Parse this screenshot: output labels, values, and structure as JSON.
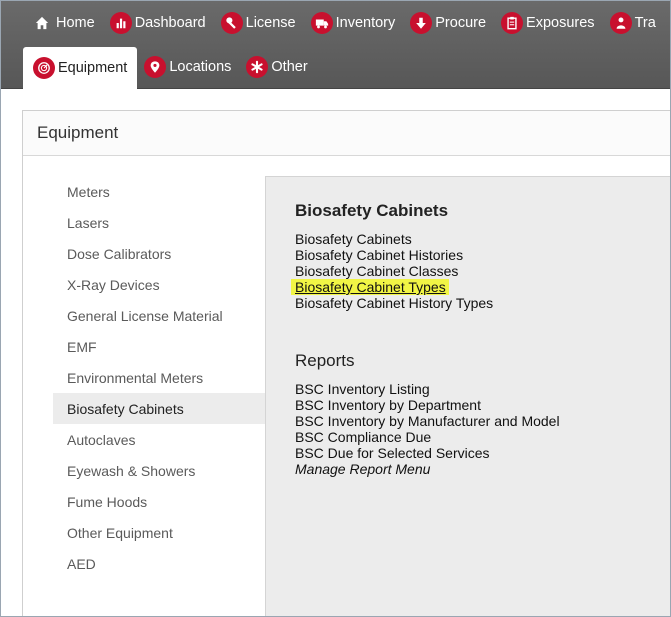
{
  "topnav": {
    "row1": [
      {
        "label": "Home",
        "icon": "home-icon"
      },
      {
        "label": "Dashboard",
        "icon": "bar-chart-icon"
      },
      {
        "label": "License",
        "icon": "wrench-icon"
      },
      {
        "label": "Inventory",
        "icon": "truck-icon"
      },
      {
        "label": "Procure",
        "icon": "down-arrow-icon"
      },
      {
        "label": "Exposures",
        "icon": "clipboard-icon"
      },
      {
        "label": "Tra",
        "icon": "person-icon"
      }
    ],
    "row2": [
      {
        "label": "Equipment",
        "icon": "gauge-icon",
        "active": true
      },
      {
        "label": "Locations",
        "icon": "map-pin-icon"
      },
      {
        "label": "Other",
        "icon": "asterisk-icon"
      }
    ]
  },
  "panel": {
    "title": "Equipment"
  },
  "sidebar": {
    "items": [
      "Meters",
      "Lasers",
      "Dose Calibrators",
      "X-Ray Devices",
      "General License Material",
      "EMF",
      "Environmental Meters",
      "Biosafety Cabinets",
      "Autoclaves",
      "Eyewash & Showers",
      "Fume Hoods",
      "Other Equipment",
      "AED"
    ],
    "selected": "Biosafety Cabinets"
  },
  "content": {
    "section_title": "Biosafety Cabinets",
    "links": [
      "Biosafety Cabinets",
      "Biosafety Cabinet Histories",
      "Biosafety Cabinet Classes",
      "Biosafety Cabinet Types",
      "Biosafety Cabinet History Types"
    ],
    "highlighted_link": "Biosafety Cabinet Types",
    "reports_title": "Reports",
    "reports": [
      "BSC Inventory Listing",
      "BSC Inventory by Department",
      "BSC Inventory by Manufacturer and Model",
      "BSC Compliance Due",
      "BSC Due for Selected Services",
      "Manage Report Menu"
    ]
  },
  "colors": {
    "nav_bg": "#5f5f5f",
    "icon_red": "#c8102e",
    "highlight": "#f1f545",
    "content_bg": "#ececec"
  }
}
